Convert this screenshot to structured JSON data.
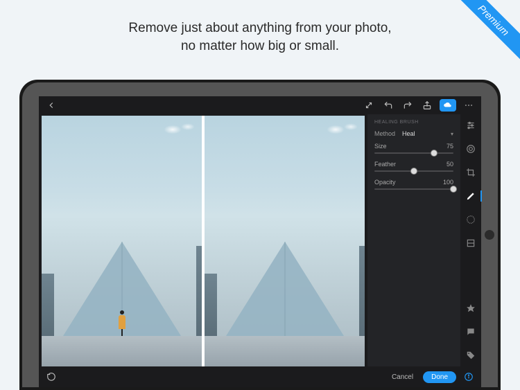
{
  "promo": {
    "line1": "Remove just about anything from your photo,",
    "line2": "no matter how big or small."
  },
  "ribbon": {
    "label": "Premium"
  },
  "panel": {
    "title": "HEALING BRUSH",
    "method_label": "Method",
    "method_value": "Heal",
    "sliders": {
      "size": {
        "label": "Size",
        "value": 75,
        "min": 0,
        "max": 100
      },
      "feather": {
        "label": "Feather",
        "value": 50,
        "min": 0,
        "max": 100
      },
      "opacity": {
        "label": "Opacity",
        "value": 100,
        "min": 0,
        "max": 100
      }
    }
  },
  "bottombar": {
    "cancel": "Cancel",
    "done": "Done"
  }
}
